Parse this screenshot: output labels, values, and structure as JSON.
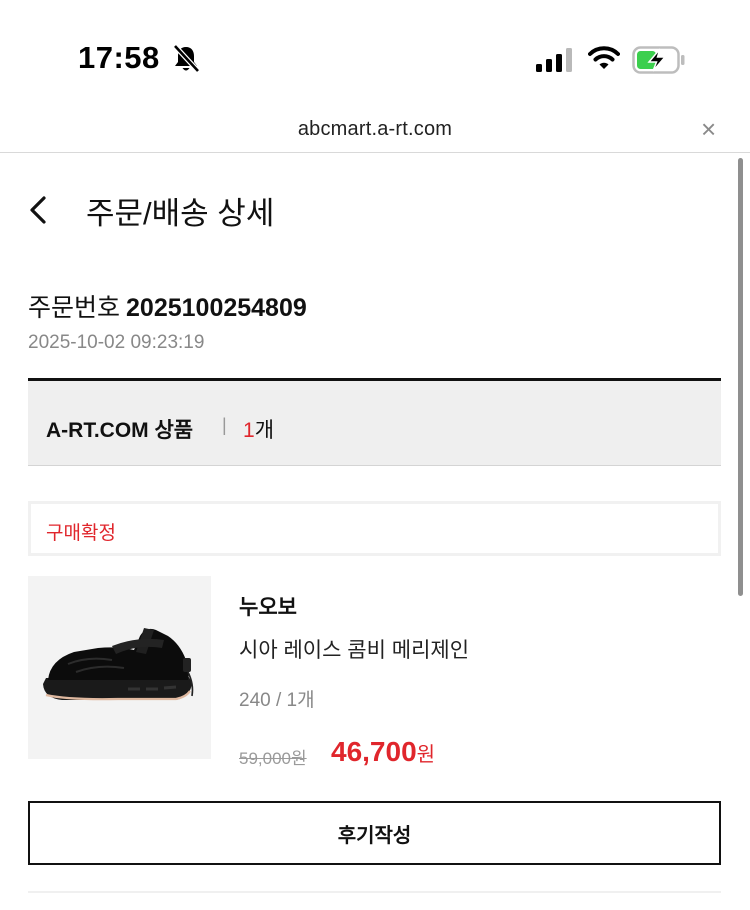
{
  "status_bar": {
    "time": "17:58",
    "icons": [
      "bell-slash-icon",
      "signal-icon",
      "wifi-icon",
      "battery-charging-icon"
    ]
  },
  "browser": {
    "url": "abcmart.a-rt.com",
    "close_icon": "×"
  },
  "header": {
    "back_icon": "chevron-left-icon",
    "title": "주문/배송 상세"
  },
  "order": {
    "number_label": "주문번호",
    "number": "2025100254809",
    "date": "2025-10-02 09:23:19"
  },
  "group": {
    "label": "A-RT.COM 상품",
    "separator": "|",
    "count": "1",
    "count_unit": "개"
  },
  "item": {
    "status": "구매확정",
    "brand": "누오보",
    "name": "시아 레이스 콤비 메리제인",
    "option": "240 / 1개",
    "original_price": "59,000원",
    "sale_price": "46,700",
    "sale_unit": "원"
  },
  "actions": {
    "review_label": "후기작성"
  },
  "colors": {
    "accent_red": "#e0262c",
    "header_bg": "#efefef",
    "battery_green": "#3ccf4e"
  }
}
